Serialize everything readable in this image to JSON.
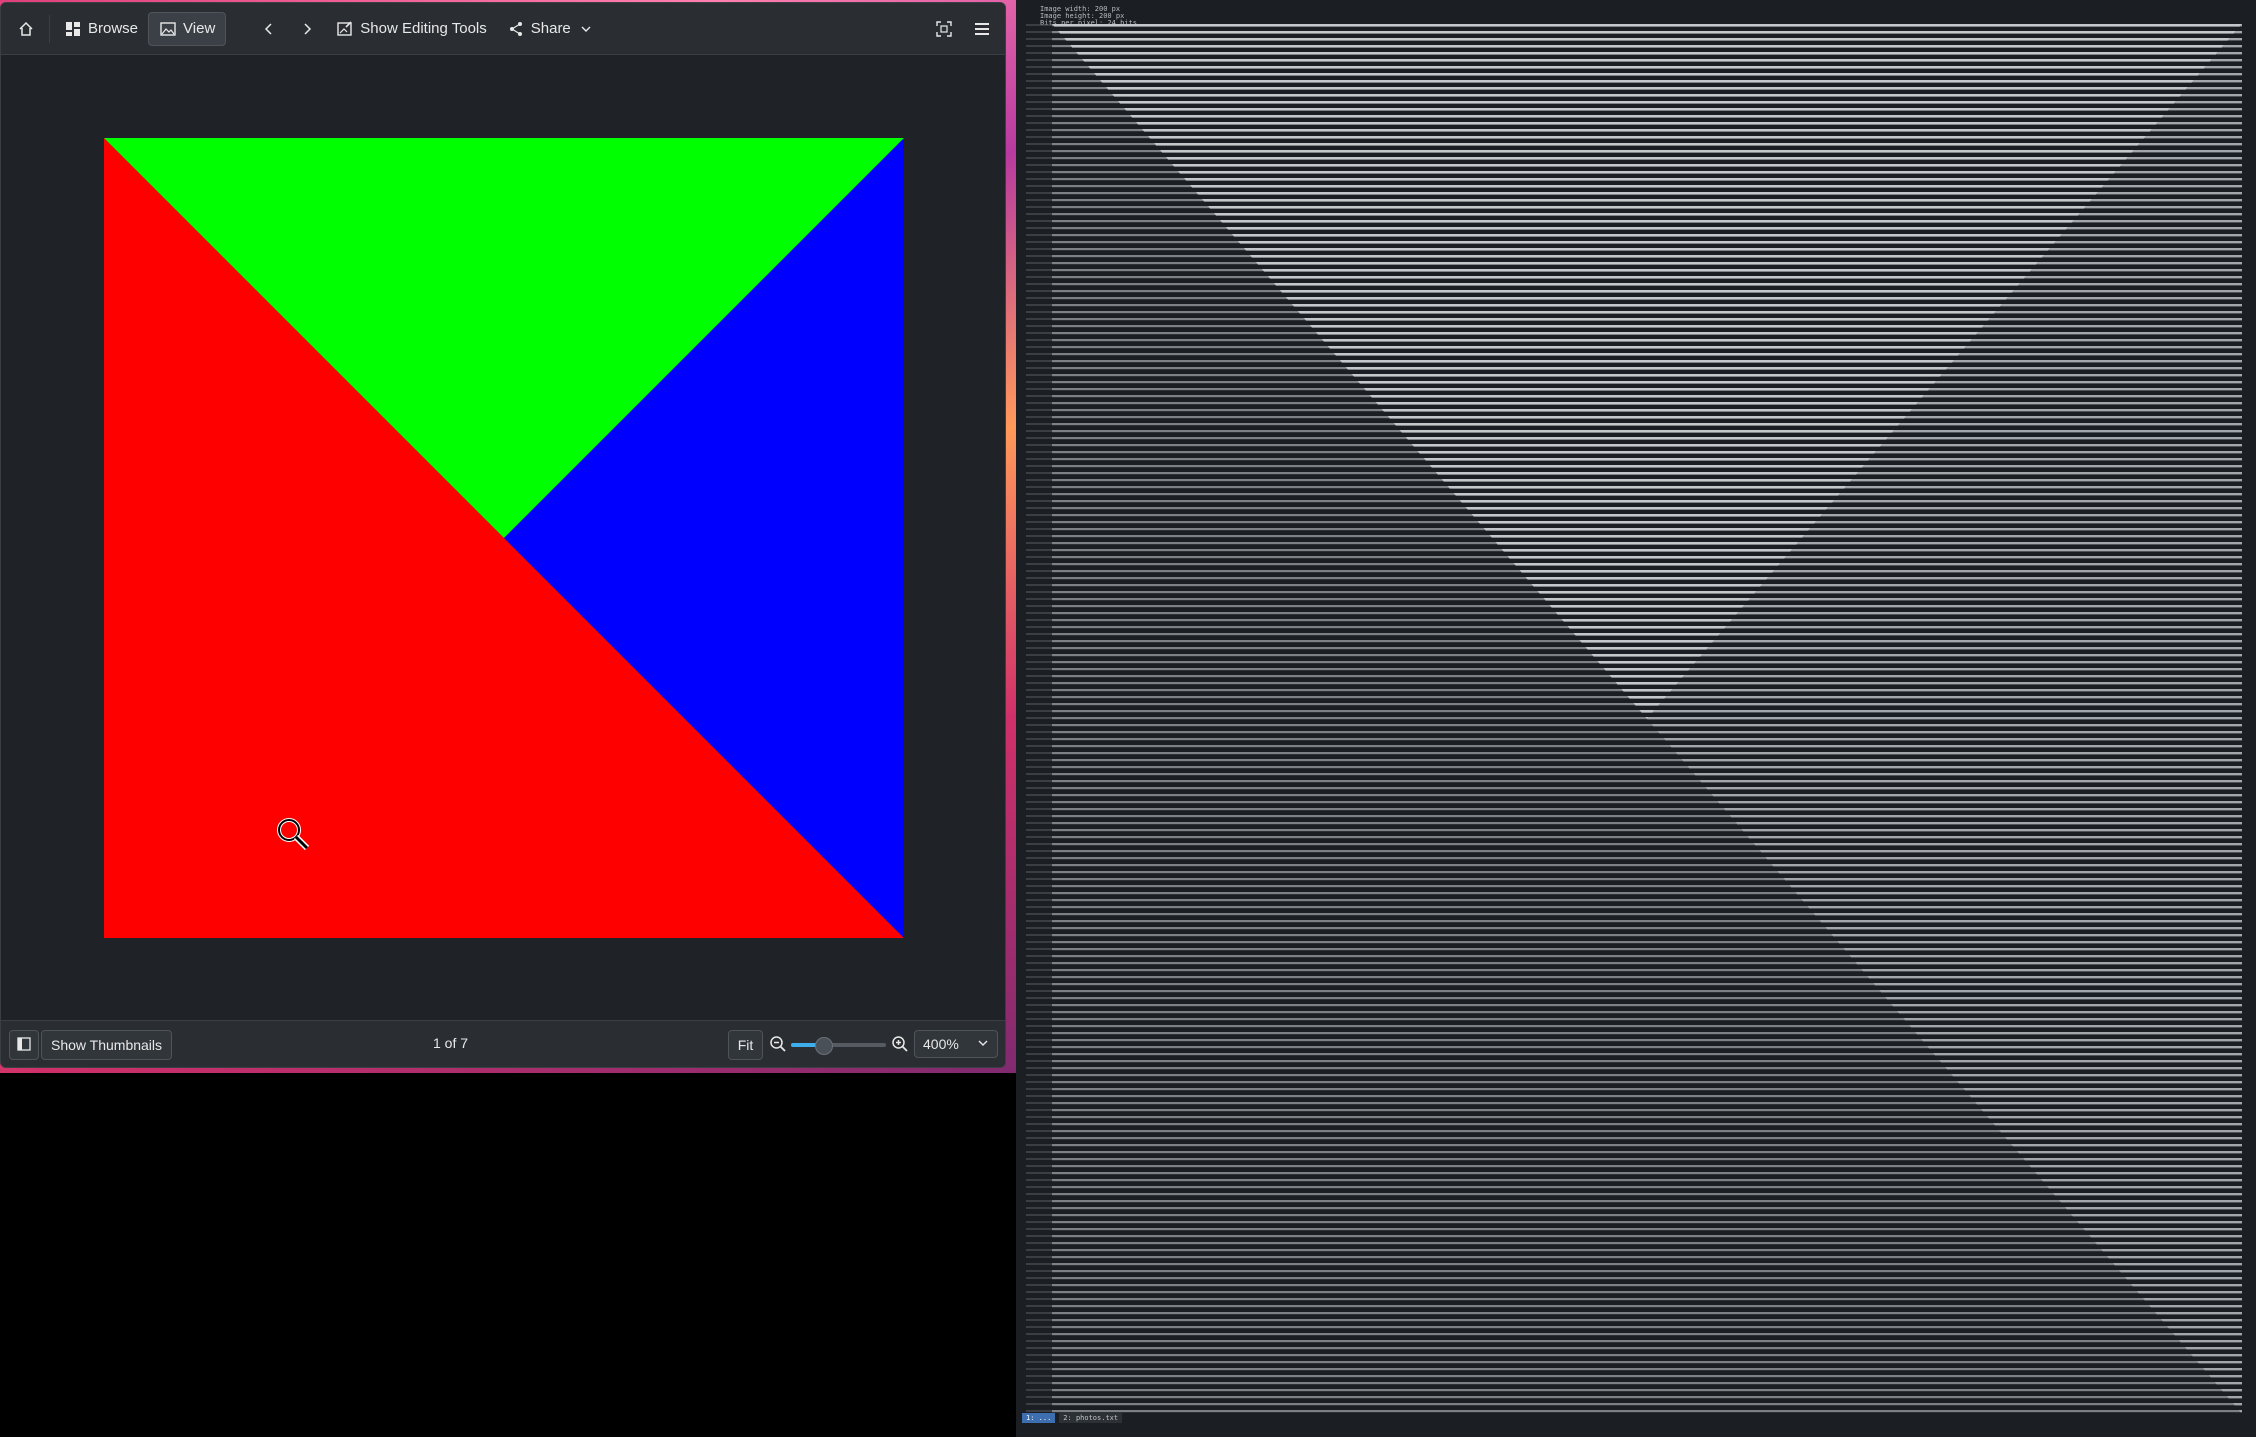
{
  "viewer": {
    "toolbar": {
      "home_icon": "home-icon",
      "browse_label": "Browse",
      "view_label": "View",
      "edit_label": "Show Editing Tools",
      "share_label": "Share",
      "fullscreen_icon": "fullscreen-icon",
      "menu_icon": "hamburger-menu-icon"
    },
    "image": {
      "colors": {
        "left": "#ff0000",
        "top": "#00ff00",
        "right": "#0000ff"
      }
    },
    "statusbar": {
      "thumbs_label": "Show Thumbnails",
      "count": "1 of 7",
      "fit_label": "Fit",
      "zoom_value": "400%",
      "zoom_slider_fraction": 0.34
    }
  },
  "terminal": {
    "header_lines": [
      "Image width: 200 px",
      "Image height: 200 px",
      "Bits per pixel: 24 bits"
    ],
    "tabs": [
      "1: ...",
      "2: photos.txt"
    ]
  }
}
